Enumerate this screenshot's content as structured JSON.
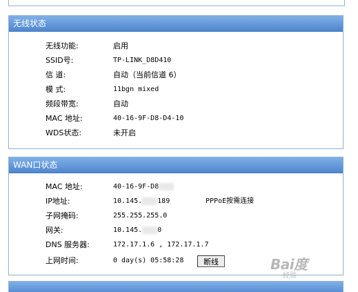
{
  "wireless_status": {
    "title": "无线状态",
    "rows": [
      {
        "label": "无线功能:",
        "value": "启用"
      },
      {
        "label": "SSID号:",
        "value": "TP-LINK_D8D410"
      },
      {
        "label": "信  道:",
        "value": "自动（当前信道 6）"
      },
      {
        "label": "模  式:",
        "value": "11bgn mixed"
      },
      {
        "label": "频段带宽:",
        "value": "自动"
      },
      {
        "label": "MAC 地址:",
        "value": "40-16-9F-D8-D4-10"
      },
      {
        "label": "WDS状态:",
        "value": "未开启"
      }
    ]
  },
  "wan_status": {
    "title": "WAN口状态",
    "mac_label": "MAC 地址:",
    "mac_value": "40-16-9F-D8",
    "ip_label": "IP地址:",
    "ip_value_a": "10.145.",
    "ip_value_b": "189",
    "connection_type": "PPPoE按需连接",
    "subnet_label": "子网掩码:",
    "subnet_value": "255.255.255.0",
    "gateway_label": "网关:",
    "gateway_value_a": "10.145.",
    "gateway_value_b": "0",
    "dns_label": "DNS 服务器:",
    "dns_value": "172.17.1.6 , 172.17.1.7",
    "uptime_label": "上网时间:",
    "uptime_value": "0 day(s) 05:58:28",
    "disconnect_label": "断线"
  },
  "watermark": {
    "logo": "Bai度",
    "sub": "经验"
  },
  "colors": {
    "header_top": "#7fb0e6",
    "header_bottom": "#4f86cf",
    "panel_border": "#8fb0d8"
  }
}
